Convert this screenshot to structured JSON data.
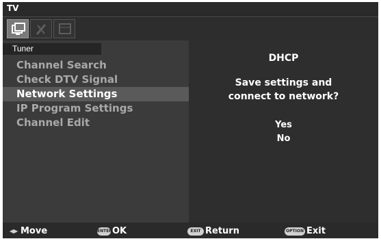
{
  "title_bar": {
    "title": "TV"
  },
  "tabs": [
    {
      "icon": "tv-settings-icon",
      "active": true
    },
    {
      "icon": "tools-icon",
      "active": false
    },
    {
      "icon": "media-icon",
      "active": false
    }
  ],
  "left_panel": {
    "heading": "Tuner",
    "items": [
      {
        "label": "Channel Search",
        "selected": false
      },
      {
        "label": "Check DTV Signal",
        "selected": false
      },
      {
        "label": "Network Settings",
        "selected": true
      },
      {
        "label": "IP Program Settings",
        "selected": false
      },
      {
        "label": "Channel Edit",
        "selected": false
      }
    ]
  },
  "dialog": {
    "title": "DHCP",
    "message_line1": "Save settings and",
    "message_line2": "connect to network?",
    "options": [
      "Yes",
      "No"
    ]
  },
  "help_bar": {
    "move": {
      "label": "Move",
      "key": "◀▶"
    },
    "ok": {
      "label": "OK",
      "key": "ENTER"
    },
    "return": {
      "label": "Return",
      "key": "EXIT"
    },
    "exit": {
      "label": "Exit",
      "key": "OPTION"
    }
  },
  "colors": {
    "screen_bg": "#3a3a3a",
    "selected_row": "#5a5a5a",
    "inactive_text": "#a9a9a9",
    "active_text": "#ffffff"
  }
}
